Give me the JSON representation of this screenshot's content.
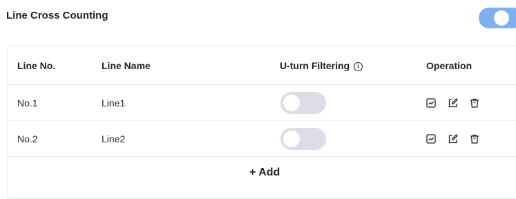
{
  "section": {
    "title": "Line Cross Counting",
    "enabled": true
  },
  "colors": {
    "accent": "#7fb0f2",
    "toggle_off": "#dcdde6"
  },
  "table": {
    "headers": {
      "line_no": "Line No.",
      "line_name": "Line Name",
      "uturn": "U-turn Filtering",
      "uturn_info_icon": "ⓘ",
      "operation": "Operation"
    },
    "rows": [
      {
        "no": "No.1",
        "name": "Line1",
        "uturn_enabled": false
      },
      {
        "no": "No.2",
        "name": "Line2",
        "uturn_enabled": false
      }
    ],
    "row_actions": [
      "chart-icon",
      "edit-icon",
      "delete-icon"
    ],
    "add_label": "+ Add"
  }
}
